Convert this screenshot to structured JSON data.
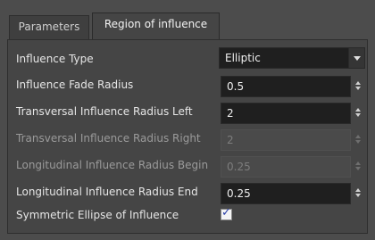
{
  "tabs": [
    {
      "label": "Parameters",
      "active": false
    },
    {
      "label": "Region of influence",
      "active": true
    }
  ],
  "influence_type": {
    "label": "Influence Type",
    "value": "Elliptic"
  },
  "fade_radius": {
    "label": "Influence Fade Radius",
    "value": "0.5"
  },
  "transversal_left": {
    "label": "Transversal Influence Radius Left",
    "value": "2"
  },
  "transversal_right": {
    "label": "Transversal Influence Radius Right",
    "value": "2",
    "enabled": false
  },
  "longitudinal_begin": {
    "label": "Longitudinal Influence Radius Begin",
    "value": "0.25",
    "enabled": false
  },
  "longitudinal_end": {
    "label": "Longitudinal Influence Radius End",
    "value": "0.25"
  },
  "symmetric": {
    "label": "Symmetric Ellipse of Influence",
    "checked": true,
    "mark": "✓"
  }
}
